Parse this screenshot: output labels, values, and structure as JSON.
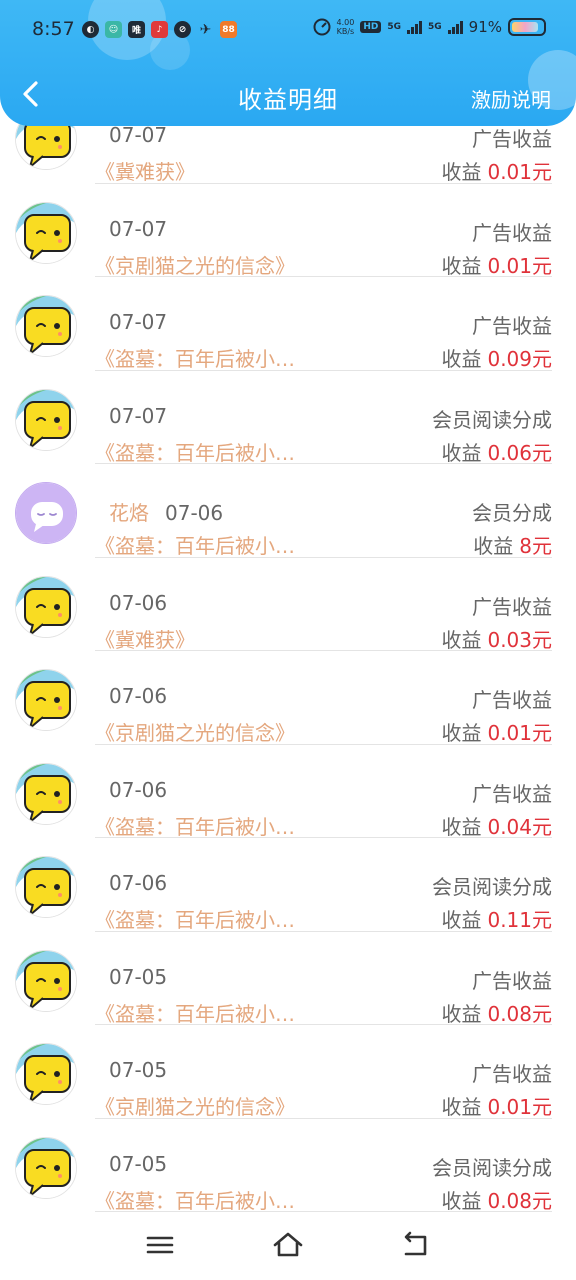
{
  "status_bar": {
    "time": "8:57",
    "network_speed": "4.00",
    "network_speed_unit": "KB/s",
    "hd_label": "HD",
    "net1": "5G",
    "net2": "5G",
    "battery_percent": "91%"
  },
  "nav": {
    "title": "收益明细",
    "right_label": "激励说明"
  },
  "records": [
    {
      "nickname": "",
      "date": "07-07",
      "book": "《冀难获》",
      "type": "广告收益",
      "label": "收益",
      "amount": "0.01元",
      "avatar": "yellow-chat"
    },
    {
      "nickname": "",
      "date": "07-07",
      "book": "《京剧猫之光的信念》",
      "type": "广告收益",
      "label": "收益",
      "amount": "0.01元",
      "avatar": "yellow-chat"
    },
    {
      "nickname": "",
      "date": "07-07",
      "book": "《盗墓：百年后被小…",
      "type": "广告收益",
      "label": "收益",
      "amount": "0.09元",
      "avatar": "yellow-chat"
    },
    {
      "nickname": "",
      "date": "07-07",
      "book": "《盗墓：百年后被小…",
      "type": "会员阅读分成",
      "label": "收益",
      "amount": "0.06元",
      "avatar": "yellow-chat"
    },
    {
      "nickname": "花烙",
      "date": "07-06",
      "book": "《盗墓：百年后被小…",
      "type": "会员分成",
      "label": "收益",
      "amount": "8元",
      "avatar": "purple-chat"
    },
    {
      "nickname": "",
      "date": "07-06",
      "book": "《冀难获》",
      "type": "广告收益",
      "label": "收益",
      "amount": "0.03元",
      "avatar": "yellow-chat"
    },
    {
      "nickname": "",
      "date": "07-06",
      "book": "《京剧猫之光的信念》",
      "type": "广告收益",
      "label": "收益",
      "amount": "0.01元",
      "avatar": "yellow-chat"
    },
    {
      "nickname": "",
      "date": "07-06",
      "book": "《盗墓：百年后被小…",
      "type": "广告收益",
      "label": "收益",
      "amount": "0.04元",
      "avatar": "yellow-chat"
    },
    {
      "nickname": "",
      "date": "07-06",
      "book": "《盗墓：百年后被小…",
      "type": "会员阅读分成",
      "label": "收益",
      "amount": "0.11元",
      "avatar": "yellow-chat"
    },
    {
      "nickname": "",
      "date": "07-05",
      "book": "《盗墓：百年后被小…",
      "type": "广告收益",
      "label": "收益",
      "amount": "0.08元",
      "avatar": "yellow-chat"
    },
    {
      "nickname": "",
      "date": "07-05",
      "book": "《京剧猫之光的信念》",
      "type": "广告收益",
      "label": "收益",
      "amount": "0.01元",
      "avatar": "yellow-chat"
    },
    {
      "nickname": "",
      "date": "07-05",
      "book": "《盗墓：百年后被小…",
      "type": "会员阅读分成",
      "label": "收益",
      "amount": "0.08元",
      "avatar": "yellow-chat"
    }
  ],
  "bottom_nav": {
    "items": [
      "menu-icon",
      "home-icon",
      "back-icon"
    ]
  },
  "colors": {
    "header": "#2aa8f2",
    "amount": "#e0323a",
    "book_title": "#e4a77e",
    "text_gray": "#666666"
  }
}
